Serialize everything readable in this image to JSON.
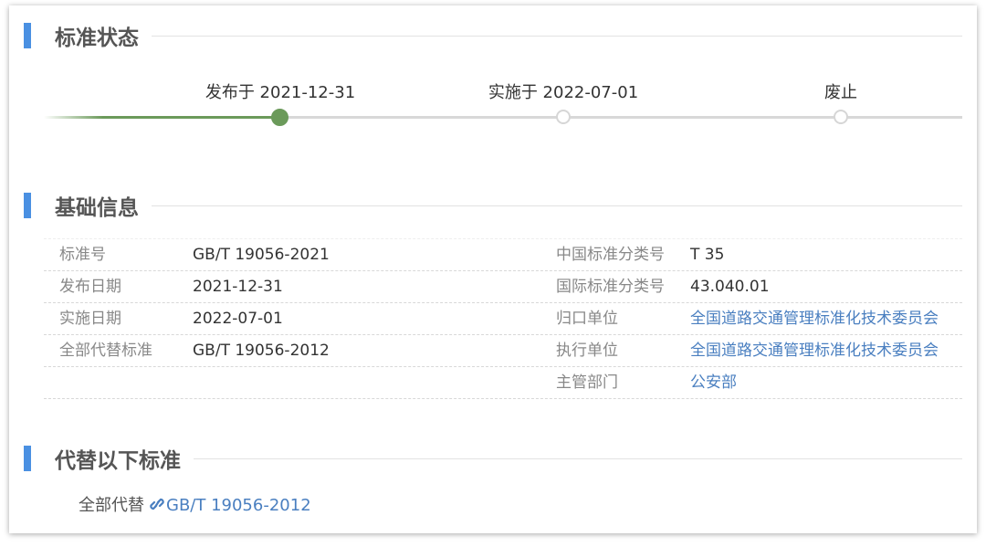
{
  "sections": {
    "status": "标准状态",
    "basic": "基础信息",
    "replaces": "代替以下标准"
  },
  "timeline": {
    "steps": [
      {
        "label": "发布于 2021-12-31",
        "active": true
      },
      {
        "label": "实施于 2022-07-01",
        "active": false
      },
      {
        "label": "废止",
        "active": false
      }
    ]
  },
  "info": {
    "rows": [
      {
        "k1": "标准号",
        "v1": "GB/T 19056-2021",
        "k2": "中国标准分类号",
        "v2": "T 35"
      },
      {
        "k1": "发布日期",
        "v1": "2021-12-31",
        "k2": "国际标准分类号",
        "v2": "43.040.01"
      },
      {
        "k1": "实施日期",
        "v1": "2022-07-01",
        "k2": "归口单位",
        "v2": "全国道路交通管理标准化技术委员会"
      },
      {
        "k1": "全部代替标准",
        "v1": "GB/T 19056-2012",
        "k2": "执行单位",
        "v2": "全国道路交通管理标准化技术委员会"
      },
      {
        "k1": "",
        "v1": "",
        "k2": "主管部门",
        "v2": "公安部"
      }
    ]
  },
  "replace": {
    "label": "全部代替",
    "link_text": "GB/T 19056-2012",
    "link_icon": "link-icon"
  },
  "colors": {
    "accent": "#4a90e2",
    "progress": "#6b9a5a",
    "link": "#4a7fc0"
  }
}
